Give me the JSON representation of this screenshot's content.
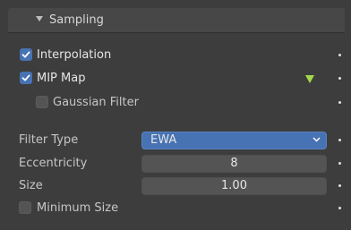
{
  "panel": {
    "title": "Sampling",
    "expanded_icon": "chevron-down-icon"
  },
  "options": {
    "interpolation": {
      "label": "Interpolation",
      "checked": true
    },
    "mip_map": {
      "label": "MIP Map",
      "checked": true
    },
    "gaussian_filter": {
      "label": "Gaussian Filter",
      "checked": false
    },
    "filter_type": {
      "label": "Filter Type",
      "value": "EWA"
    },
    "eccentricity": {
      "label": "Eccentricity",
      "value": "8"
    },
    "size": {
      "label": "Size",
      "value": "1.00"
    },
    "minimum_size": {
      "label": "Minimum Size",
      "checked": false
    }
  },
  "colors": {
    "accent": "#4772b3",
    "keyframe_indicator": "#a6d94a",
    "panel_bg": "#3d3d3d",
    "header_bg": "#474747"
  }
}
